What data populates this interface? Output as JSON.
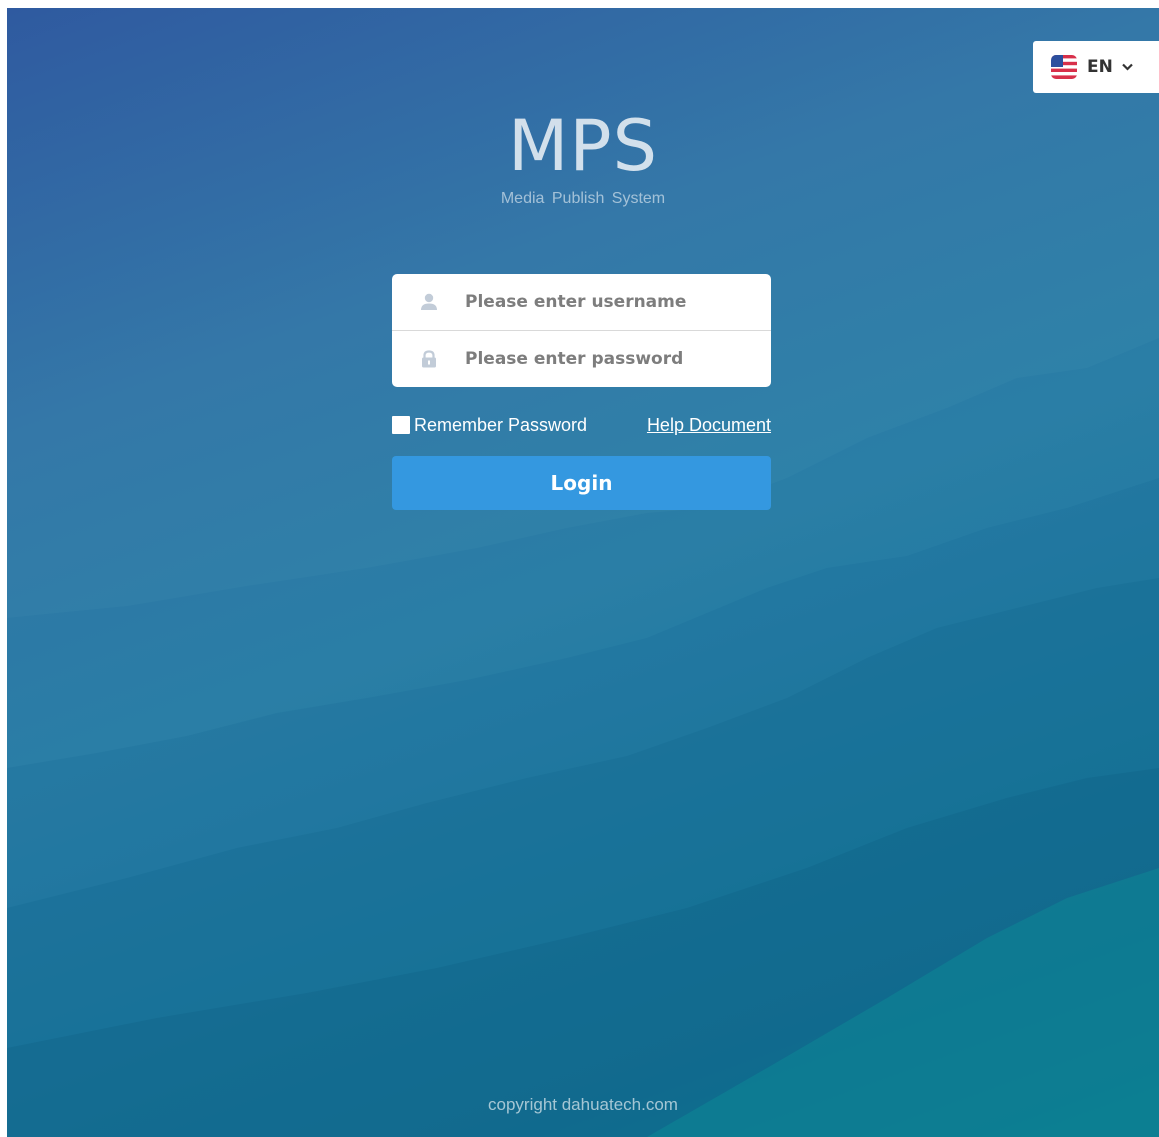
{
  "language": {
    "code": "EN",
    "flag_icon": "us-flag-icon"
  },
  "brand": {
    "title": "MPS",
    "subtitle": "Media Publish System"
  },
  "login_form": {
    "username": {
      "placeholder": "Please enter username",
      "value": "",
      "icon": "user-icon"
    },
    "password": {
      "placeholder": "Please enter password",
      "value": "",
      "icon": "lock-icon"
    },
    "remember_label": "Remember Password",
    "remember_checked": false,
    "help_link": "Help Document",
    "submit_label": "Login"
  },
  "footer": {
    "copyright": "copyright dahuatech.com"
  },
  "colors": {
    "button": "#3498e0",
    "background_top": "#2f5aa0",
    "background_bottom": "#0a8e96"
  }
}
